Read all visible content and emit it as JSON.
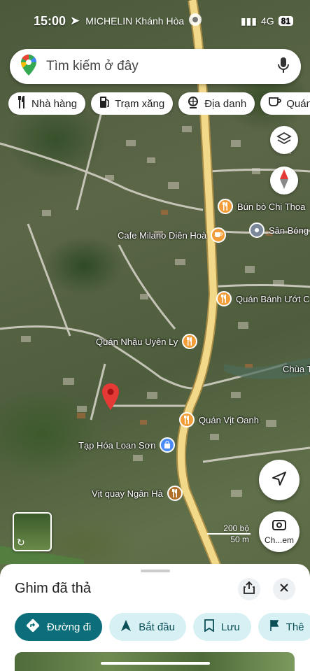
{
  "status_bar": {
    "time": "15:00",
    "place": "MICHELIN Khánh Hòa",
    "network": "4G",
    "battery": "81"
  },
  "search": {
    "placeholder": "Tìm kiếm ở đây"
  },
  "chips": [
    {
      "label": "Nhà hàng",
      "icon": "fork-knife-icon"
    },
    {
      "label": "Trạm xăng",
      "icon": "gas-station-icon"
    },
    {
      "label": "Địa danh",
      "icon": "landmark-icon"
    },
    {
      "label": "Quán",
      "icon": "coffee-icon"
    }
  ],
  "places": [
    {
      "name": "Bún bò Chị Thoa",
      "icon": "restaurant-icon"
    },
    {
      "name": "Cafe Milano Diên Hoà",
      "icon": "cafe-icon"
    },
    {
      "name": "Sân Bóng",
      "icon": "place-icon"
    },
    {
      "name": "Quán Bánh Ướt C",
      "icon": "restaurant-icon"
    },
    {
      "name": "Quán Nhậu Uyên Ly",
      "icon": "restaurant-icon"
    },
    {
      "name": "Chùa T",
      "icon": "temple-icon"
    },
    {
      "name": "Quán Vịt Oanh",
      "icon": "restaurant-icon"
    },
    {
      "name": "Tạp Hóa Loan Sơn",
      "icon": "shopping-icon"
    },
    {
      "name": "Vịt quay Ngân Hà",
      "icon": "restaurant-icon"
    }
  ],
  "scale": {
    "imperial": "200 bộ",
    "metric": "50 m"
  },
  "street_view_label": "Ch...em",
  "sheet": {
    "title": "Ghim đã thả",
    "actions": [
      {
        "label": "Đường đi",
        "icon": "directions-icon"
      },
      {
        "label": "Bắt đầu",
        "icon": "navigation-icon"
      },
      {
        "label": "Lưu",
        "icon": "bookmark-icon"
      },
      {
        "label": "Thê",
        "icon": "flag-icon"
      }
    ]
  },
  "colors": {
    "primary": "#0b6e7a",
    "secondary": "#d6f0f4",
    "road": "#f2d98a",
    "poi": "#f29d38",
    "pin": "#e53935"
  }
}
